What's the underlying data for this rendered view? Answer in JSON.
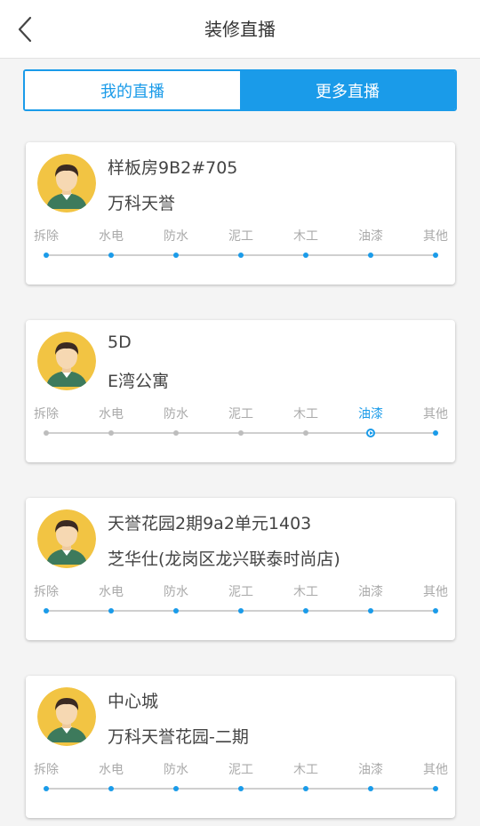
{
  "header": {
    "title": "装修直播",
    "back_icon": "chevron-left-icon"
  },
  "tabs": [
    {
      "label": "我的直播",
      "active": false
    },
    {
      "label": "更多直播",
      "active": true
    }
  ],
  "colors": {
    "accent": "#1a9be9",
    "avatar_bg": "#f2c443",
    "pending_dot": "#bdbdbd"
  },
  "stage_names": [
    "拆除",
    "水电",
    "防水",
    "泥工",
    "木工",
    "油漆",
    "其他"
  ],
  "cards": [
    {
      "title": "样板房9B2#705",
      "subtitle": "万科天誉",
      "current_stage": null,
      "stages": [
        "拆除",
        "水电",
        "防水",
        "泥工",
        "木工",
        "油漆",
        "其他"
      ]
    },
    {
      "title": "5D",
      "subtitle": "E湾公寓",
      "current_stage": "油漆",
      "stages": [
        "拆除",
        "水电",
        "防水",
        "泥工",
        "木工",
        "油漆",
        "其他"
      ]
    },
    {
      "title": "天誉花园2期9a2单元1403",
      "subtitle": "芝华仕(龙岗区龙兴联泰时尚店)",
      "current_stage": null,
      "stages": [
        "拆除",
        "水电",
        "防水",
        "泥工",
        "木工",
        "油漆",
        "其他"
      ]
    },
    {
      "title": "中心城",
      "subtitle": "万科天誉花园-二期",
      "current_stage": null,
      "stages": [
        "拆除",
        "水电",
        "防水",
        "泥工",
        "木工",
        "油漆",
        "其他"
      ]
    }
  ]
}
